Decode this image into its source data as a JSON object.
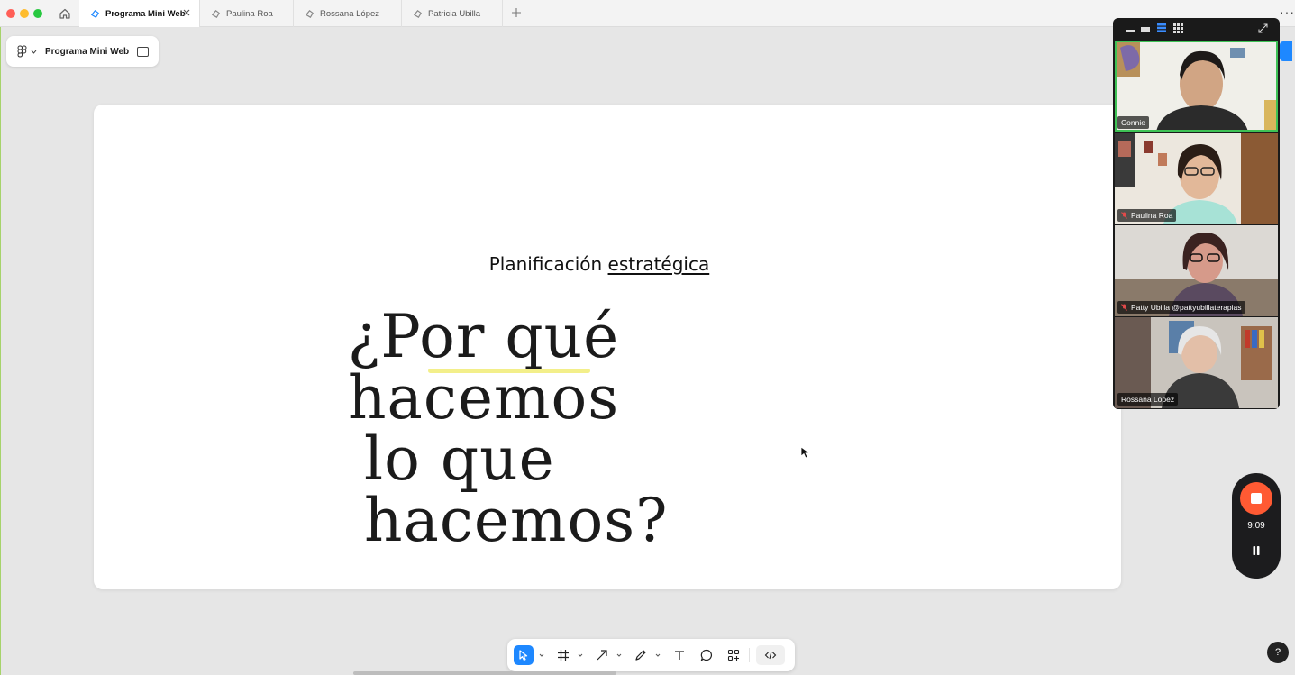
{
  "tabs": [
    {
      "label": "Programa Mini Web",
      "active": true
    },
    {
      "label": "Paulina Roa",
      "active": false
    },
    {
      "label": "Rossana López",
      "active": false
    },
    {
      "label": "Patricia Ubilla",
      "active": false
    }
  ],
  "file": {
    "name": "Programa Mini Web"
  },
  "slide": {
    "subtitle_plain": "Planificación",
    "subtitle_underlined": "estratégica",
    "headline_line1": "¿Por qué hacemos",
    "headline_line2": "lo que hacemos?"
  },
  "participants": [
    {
      "name": "Connie",
      "muted": false
    },
    {
      "name": "Paulina Roa",
      "muted": true
    },
    {
      "name": "Patty Ubilla  @pattyubillaterapias",
      "muted": true
    },
    {
      "name": "Rossana López",
      "muted": false
    }
  ],
  "recording": {
    "time": "9:09"
  },
  "help": {
    "label": "?"
  },
  "colors": {
    "accent": "#1e88ff",
    "record": "#ff5a33",
    "speaker": "#3ec255"
  },
  "icons": {
    "home": "home-icon",
    "figma": "figma-icon",
    "move": "move-tool-icon",
    "frame": "frame-tool-icon",
    "arrow": "arrow-tool-icon",
    "pencil": "pencil-tool-icon",
    "text": "text-tool-icon",
    "comment": "comment-tool-icon",
    "components": "components-tool-icon",
    "dev": "dev-mode-icon"
  }
}
